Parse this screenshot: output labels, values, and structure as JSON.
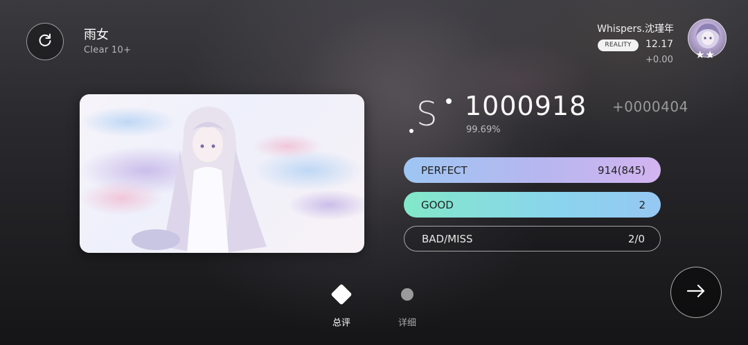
{
  "song": {
    "title": "雨女",
    "level": "Clear 10+"
  },
  "player": {
    "name": "Whispers.沈瑾年",
    "badge": "REALITY",
    "rating": "12.17",
    "rating_change": "+0.00",
    "stars": "★★"
  },
  "result": {
    "grade": "S",
    "score": "1000918",
    "accuracy": "99.69%",
    "score_diff": "+0000404"
  },
  "judgements": [
    {
      "label": "PERFECT",
      "value": "914(845)"
    },
    {
      "label": "GOOD",
      "value": "2"
    },
    {
      "label": "BAD/MISS",
      "value": "2/0"
    }
  ],
  "tabs": [
    {
      "label": "总评",
      "active": true
    },
    {
      "label": "详细",
      "active": false
    }
  ],
  "icons": {
    "retry": "retry-icon",
    "next": "arrow-right-icon"
  },
  "colors": {
    "perfect_start": "#9ec6f3",
    "perfect_end": "#d3b4f0",
    "good_start": "#82e8c9",
    "good_end": "#96c7f3"
  }
}
